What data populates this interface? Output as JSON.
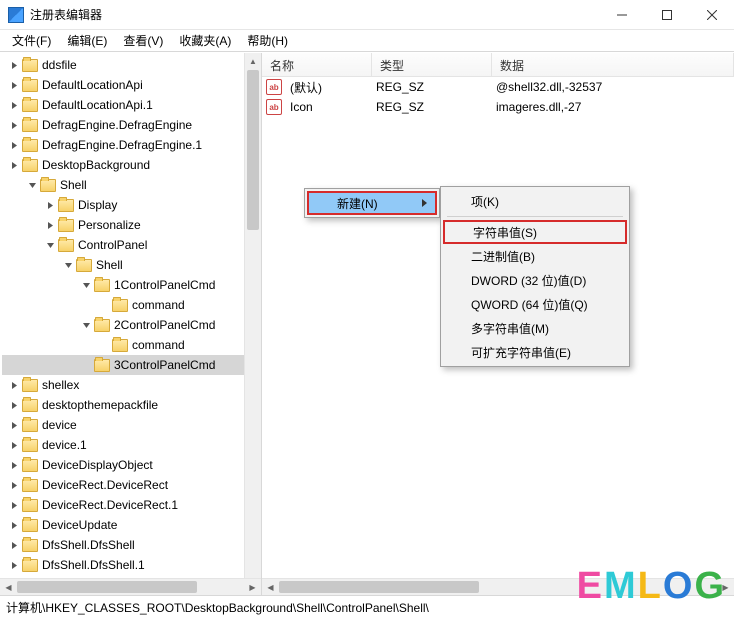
{
  "window": {
    "title": "注册表编辑器",
    "min_tooltip": "Minimize",
    "max_tooltip": "Maximize",
    "close_tooltip": "Close"
  },
  "menubar": {
    "file": "文件(F)",
    "edit": "编辑(E)",
    "view": "查看(V)",
    "favorites": "收藏夹(A)",
    "help": "帮助(H)"
  },
  "tree": {
    "items": [
      {
        "depth": 0,
        "twisty": "closed",
        "label": "ddsfile"
      },
      {
        "depth": 0,
        "twisty": "closed",
        "label": "DefaultLocationApi"
      },
      {
        "depth": 0,
        "twisty": "closed",
        "label": "DefaultLocationApi.1"
      },
      {
        "depth": 0,
        "twisty": "closed",
        "label": "DefragEngine.DefragEngine"
      },
      {
        "depth": 0,
        "twisty": "closed",
        "label": "DefragEngine.DefragEngine.1"
      },
      {
        "depth": 0,
        "twisty": "closed",
        "label": "DesktopBackground"
      },
      {
        "depth": 1,
        "twisty": "open",
        "label": "Shell"
      },
      {
        "depth": 2,
        "twisty": "closed",
        "label": "Display"
      },
      {
        "depth": 2,
        "twisty": "closed",
        "label": "Personalize"
      },
      {
        "depth": 2,
        "twisty": "open",
        "label": "ControlPanel"
      },
      {
        "depth": 3,
        "twisty": "open",
        "label": "Shell"
      },
      {
        "depth": 4,
        "twisty": "open",
        "label": "1ControlPanelCmd"
      },
      {
        "depth": 5,
        "twisty": "blank",
        "label": "command"
      },
      {
        "depth": 4,
        "twisty": "open",
        "label": "2ControlPanelCmd"
      },
      {
        "depth": 5,
        "twisty": "blank",
        "label": "command"
      },
      {
        "depth": 4,
        "twisty": "blank",
        "label": "3ControlPanelCmd",
        "selected": true
      },
      {
        "depth": 0,
        "twisty": "closed",
        "label": "shellex"
      },
      {
        "depth": 0,
        "twisty": "closed",
        "label": "desktopthemepackfile"
      },
      {
        "depth": 0,
        "twisty": "closed",
        "label": "device"
      },
      {
        "depth": 0,
        "twisty": "closed",
        "label": "device.1"
      },
      {
        "depth": 0,
        "twisty": "closed",
        "label": "DeviceDisplayObject"
      },
      {
        "depth": 0,
        "twisty": "closed",
        "label": "DeviceRect.DeviceRect"
      },
      {
        "depth": 0,
        "twisty": "closed",
        "label": "DeviceRect.DeviceRect.1"
      },
      {
        "depth": 0,
        "twisty": "closed",
        "label": "DeviceUpdate"
      },
      {
        "depth": 0,
        "twisty": "closed",
        "label": "DfsShell.DfsShell"
      },
      {
        "depth": 0,
        "twisty": "closed",
        "label": "DfsShell.DfsShell.1"
      }
    ]
  },
  "list": {
    "columns": {
      "name": "名称",
      "type": "类型",
      "data": "数据"
    },
    "col_widths": {
      "name": 110,
      "type": 120,
      "data": 200
    },
    "rows": [
      {
        "icon": "ab",
        "name": "(默认)",
        "type": "REG_SZ",
        "data": "@shell32.dll,-32537"
      },
      {
        "icon": "ab",
        "name": "Icon",
        "type": "REG_SZ",
        "data": "imageres.dll,-27"
      }
    ]
  },
  "context1": {
    "new": "新建(N)"
  },
  "context2": {
    "key": "项(K)",
    "string": "字符串值(S)",
    "binary": "二进制值(B)",
    "dword": "DWORD (32 位)值(D)",
    "qword": "QWORD (64 位)值(Q)",
    "multistring": "多字符串值(M)",
    "expandstring": "可扩充字符串值(E)"
  },
  "statusbar": {
    "path": "计算机\\HKEY_CLASSES_ROOT\\DesktopBackground\\Shell\\ControlPanel\\Shell\\"
  },
  "watermark": {
    "e": "E",
    "m": "M",
    "l": "L",
    "o": "O",
    "g": "G"
  }
}
